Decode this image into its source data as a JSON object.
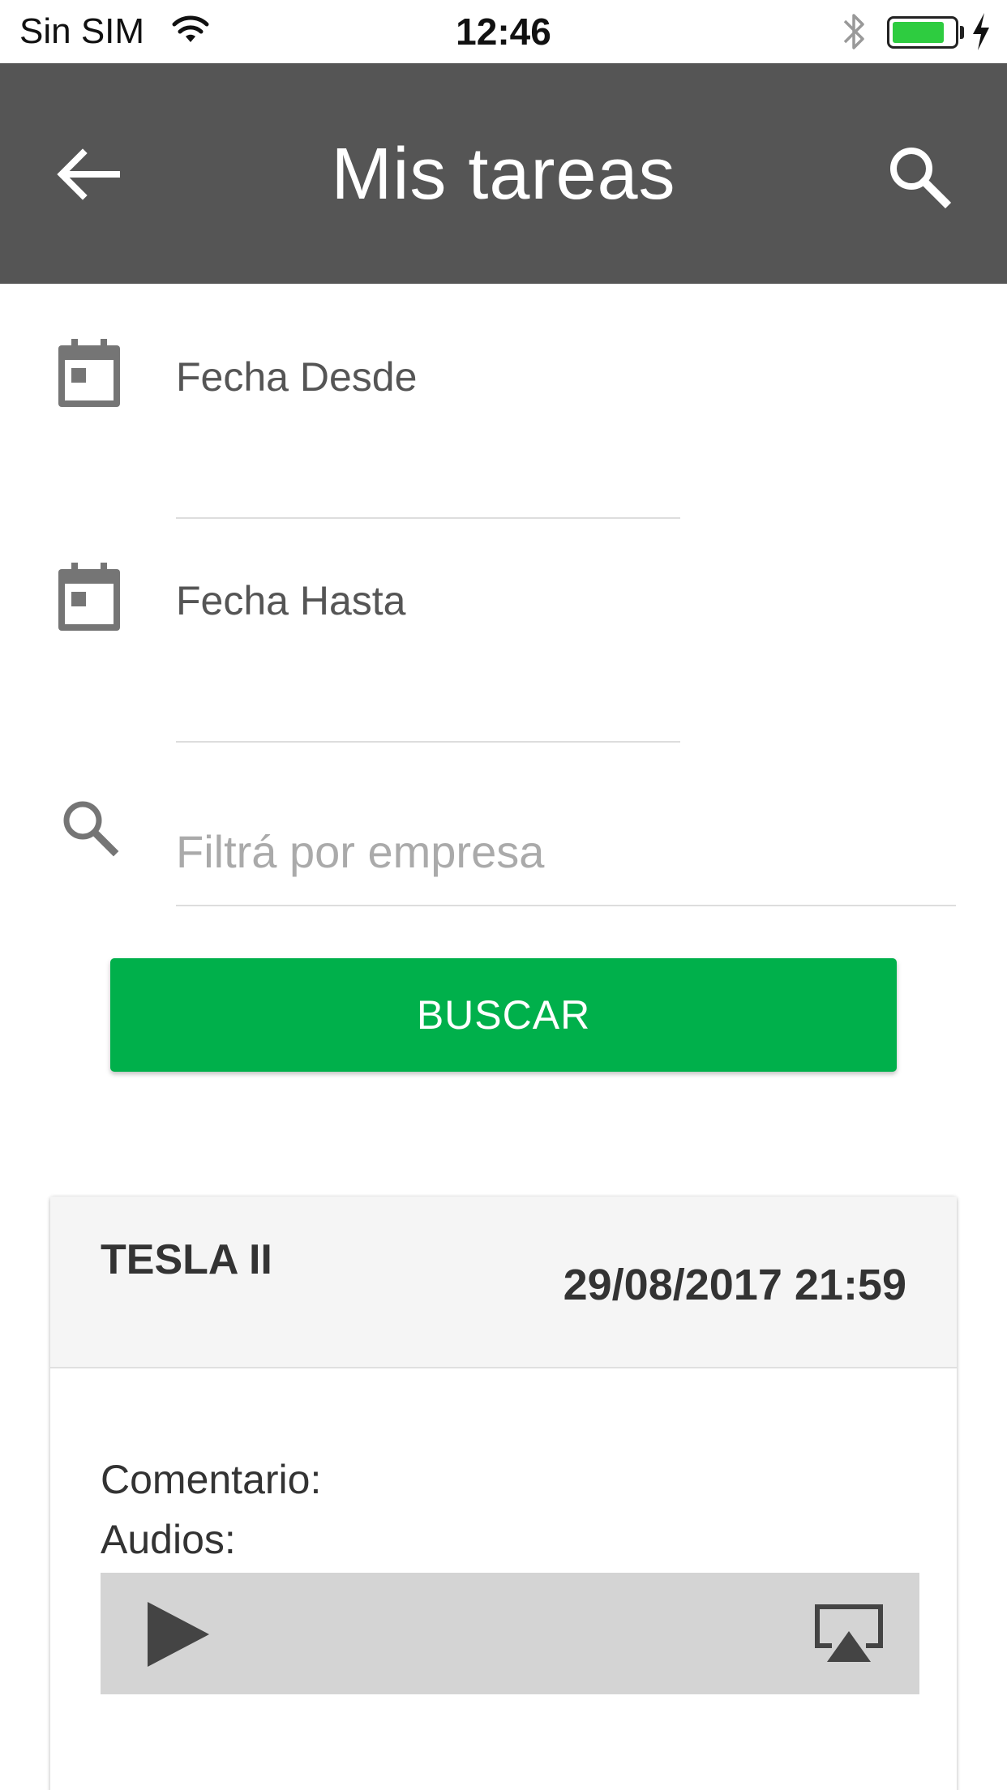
{
  "status_bar": {
    "carrier": "Sin SIM",
    "time": "12:46",
    "battery_level": 0.85
  },
  "app_bar": {
    "title": "Mis tareas",
    "back_icon": "arrow-left-icon",
    "search_icon": "search-icon"
  },
  "filters": {
    "date_from_label": "Fecha Desde",
    "date_to_label": "Fecha Hasta",
    "company_placeholder": "Filtrá por empresa",
    "company_value": "",
    "search_button_label": "BUSCAR"
  },
  "colors": {
    "app_bar": "#555555",
    "accent": "#00b04b",
    "card_header": "#f5f5f5",
    "audio_player": "#d4d4d4"
  },
  "tasks": [
    {
      "company": "TESLA II",
      "datetime": "29/08/2017 21:59",
      "comment_label": "Comentario:",
      "audios_label": "Audios:"
    }
  ]
}
